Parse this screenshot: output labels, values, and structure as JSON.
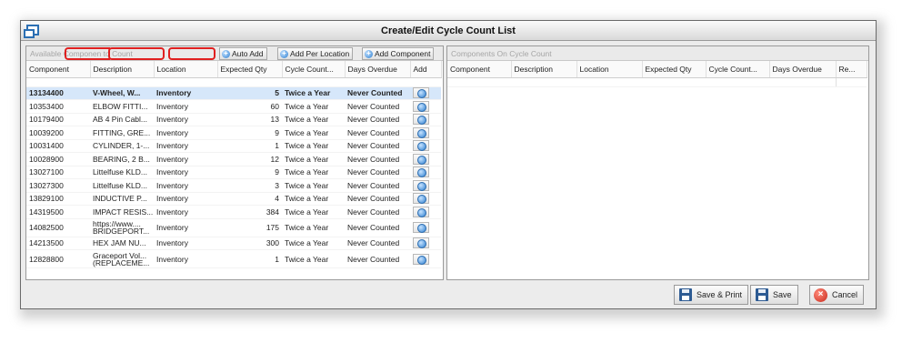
{
  "window": {
    "title": "Create/Edit Cycle Count List"
  },
  "left_panel": {
    "header_label_parts": [
      "Available ",
      "Componen",
      "to Count"
    ],
    "toolbar": {
      "auto_add": "Auto Add",
      "add_per_location": "Add Per Location",
      "add_component": "Add Component"
    },
    "columns": [
      "Component",
      "Description",
      "Location",
      "Expected Qty",
      "Cycle Count...",
      "Days Overdue",
      "Add"
    ],
    "rows": [
      {
        "component": "13134400",
        "description": "V-Wheel, W...",
        "location": "Inventory",
        "qty": "5",
        "cycle": "Twice a Year",
        "overdue": "Never Counted"
      },
      {
        "component": "10353400",
        "description": "ELBOW FITTI...",
        "location": "Inventory",
        "qty": "60",
        "cycle": "Twice a Year",
        "overdue": "Never Counted"
      },
      {
        "component": "10179400",
        "description": "AB 4 Pin Cabl...",
        "location": "Inventory",
        "qty": "13",
        "cycle": "Twice a Year",
        "overdue": "Never Counted"
      },
      {
        "component": "10039200",
        "description": "FITTING, GRE...",
        "location": "Inventory",
        "qty": "9",
        "cycle": "Twice a Year",
        "overdue": "Never Counted"
      },
      {
        "component": "10031400",
        "description": "CYLINDER, 1-...",
        "location": "Inventory",
        "qty": "1",
        "cycle": "Twice a Year",
        "overdue": "Never Counted"
      },
      {
        "component": "10028900",
        "description": "BEARING, 2 B...",
        "location": "Inventory",
        "qty": "12",
        "cycle": "Twice a Year",
        "overdue": "Never Counted"
      },
      {
        "component": "13027100",
        "description": "Littelfuse KLD...",
        "location": "Inventory",
        "qty": "9",
        "cycle": "Twice a Year",
        "overdue": "Never Counted"
      },
      {
        "component": "13027300",
        "description": "Littelfuse KLD...",
        "location": "Inventory",
        "qty": "3",
        "cycle": "Twice a Year",
        "overdue": "Never Counted"
      },
      {
        "component": "13829100",
        "description": "INDUCTIVE P...",
        "location": "Inventory",
        "qty": "4",
        "cycle": "Twice a Year",
        "overdue": "Never Counted"
      },
      {
        "component": "14319500",
        "description": "IMPACT RESIS...",
        "location": "Inventory",
        "qty": "384",
        "cycle": "Twice a Year",
        "overdue": "Never Counted"
      },
      {
        "component": "14082500",
        "description": "https://www.... BRIDGEPORT...",
        "location": "Inventory",
        "qty": "175",
        "cycle": "Twice a Year",
        "overdue": "Never Counted"
      },
      {
        "component": "14213500",
        "description": "HEX JAM NU...",
        "location": "Inventory",
        "qty": "300",
        "cycle": "Twice a Year",
        "overdue": "Never Counted"
      },
      {
        "component": "12828800",
        "description": "Graceport Vol... (REPLACEME...",
        "location": "Inventory",
        "qty": "1",
        "cycle": "Twice a Year",
        "overdue": "Never Counted"
      }
    ]
  },
  "right_panel": {
    "header_label": "Components On Cycle Count",
    "columns": [
      "Component",
      "Description",
      "Location",
      "Expected Qty",
      "Cycle Count...",
      "Days Overdue",
      "Re..."
    ]
  },
  "footer": {
    "save_print": "Save & Print",
    "save": "Save",
    "cancel": "Cancel"
  },
  "colors": {
    "selected_row": "#d6e7fa",
    "annotation": "#e02020",
    "accent": "#2f7fd0"
  }
}
